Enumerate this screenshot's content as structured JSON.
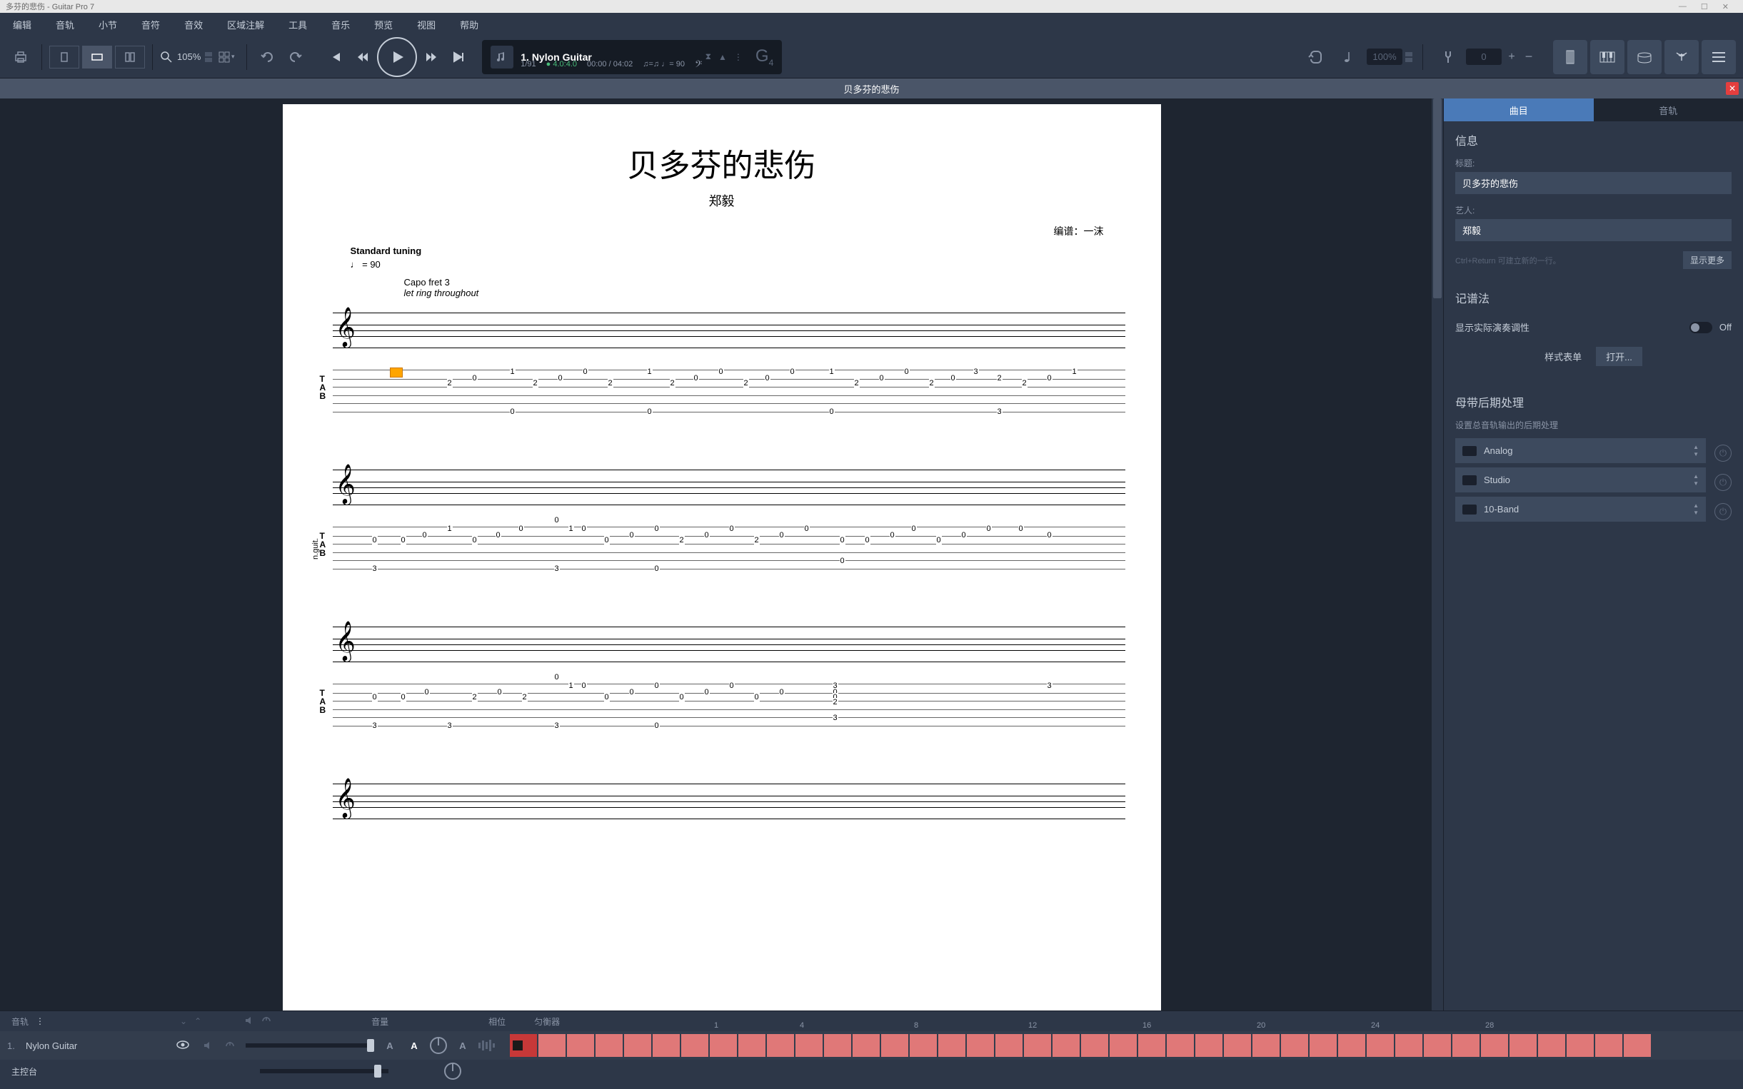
{
  "titlebar": {
    "text": "多芬的悲伤 - Guitar Pro 7"
  },
  "menu": [
    "编辑",
    "音轨",
    "小节",
    "音符",
    "音效",
    "区域注解",
    "工具",
    "音乐",
    "预览",
    "视图",
    "帮助"
  ],
  "toolbar": {
    "zoom": "105%",
    "track_display": {
      "name": "1. Nylon Guitar",
      "bar_pos": "1/91",
      "beat": "4.0:4.0",
      "time": "00:00 / 04:02",
      "tempo_icons": "♫=♫ ♩=",
      "tempo_val": "90",
      "key": "G",
      "key_sub": "4"
    },
    "speed_pct": "100%",
    "pitch_semitone": "0"
  },
  "tab_header": "贝多芬的悲伤",
  "score": {
    "title": "贝多芬的悲伤",
    "subtitle": "郑毅",
    "arranger": "编谱：一沫",
    "tuning": "Standard tuning",
    "tempo": "♩ = 90",
    "capo": "Capo fret 3",
    "ring": "let ring throughout",
    "track_label": "n.guit."
  },
  "side_panel": {
    "tabs": {
      "song": "曲目",
      "track": "音轨"
    },
    "info": {
      "header": "信息",
      "title_label": "标题:",
      "title_value": "贝多芬的悲伤",
      "artist_label": "艺人:",
      "artist_value": "郑毅",
      "hint": "Ctrl+Return 可建立新的一行。",
      "show_more": "显示更多"
    },
    "notation": {
      "header": "记谱法",
      "tuning_toggle": "显示实际演奏调性",
      "off": "Off",
      "stylesheet": "样式表单",
      "open": "打开..."
    },
    "mastering": {
      "header": "母带后期处理",
      "desc": "设置总音轨输出的后期处理",
      "items": [
        "Analog",
        "Studio",
        "10-Band"
      ]
    }
  },
  "bottom": {
    "track_header": "音轨",
    "volume": "音量",
    "pan": "相位",
    "eq": "匀衡器",
    "bar_numbers": [
      "1",
      "4",
      "8",
      "12",
      "16",
      "20",
      "24",
      "28"
    ],
    "track": {
      "num": "1.",
      "name": "Nylon Guitar"
    },
    "console": "主控台"
  },
  "tab_data": {
    "line1": [
      {
        "bar": 1,
        "notes": [
          {
            "s": 6,
            "f": 0,
            "p": 0
          },
          {
            "s": 4,
            "f": 2,
            "p": 1
          },
          {
            "s": 3,
            "f": 0,
            "p": 2
          },
          {
            "s": 6,
            "f": 0,
            "p": 3
          },
          {
            "s": 2,
            "f": 1,
            "p": 4
          },
          {
            "s": 4,
            "f": 2,
            "p": 5
          },
          {
            "s": 2,
            "f": 0,
            "p": 6
          },
          {
            "s": 3,
            "f": 2,
            "p": 7
          }
        ]
      },
      {
        "bar": 2,
        "notes": [
          {
            "s": 6,
            "f": 0,
            "p": 0
          },
          {
            "s": 4,
            "f": 2,
            "p": 1
          },
          {
            "s": 3,
            "f": 2,
            "p": 2
          },
          {
            "s": 2,
            "f": 0,
            "p": 3
          },
          {
            "s": 2,
            "f": 0,
            "p": 4
          },
          {
            "s": 4,
            "f": 2,
            "p": 5
          },
          {
            "s": 3,
            "f": 2,
            "p": 6
          },
          {
            "s": 2,
            "f": 0,
            "p": 7
          }
        ]
      },
      {
        "bar": 3,
        "notes": [
          {
            "s": 6,
            "f": 0,
            "p": 0
          },
          {
            "s": 4,
            "f": 2,
            "p": 1
          },
          {
            "s": 3,
            "f": 0,
            "p": 2
          },
          {
            "s": 6,
            "f": 0,
            "p": 3
          },
          {
            "s": 2,
            "f": 3,
            "p": 4
          },
          {
            "s": 4,
            "f": 2,
            "p": 5
          },
          {
            "s": 2,
            "f": 1,
            "p": 6
          },
          {
            "s": 3,
            "f": 2,
            "p": 7
          },
          {
            "s": 6,
            "f": 0,
            "p": 8
          }
        ]
      }
    ]
  }
}
